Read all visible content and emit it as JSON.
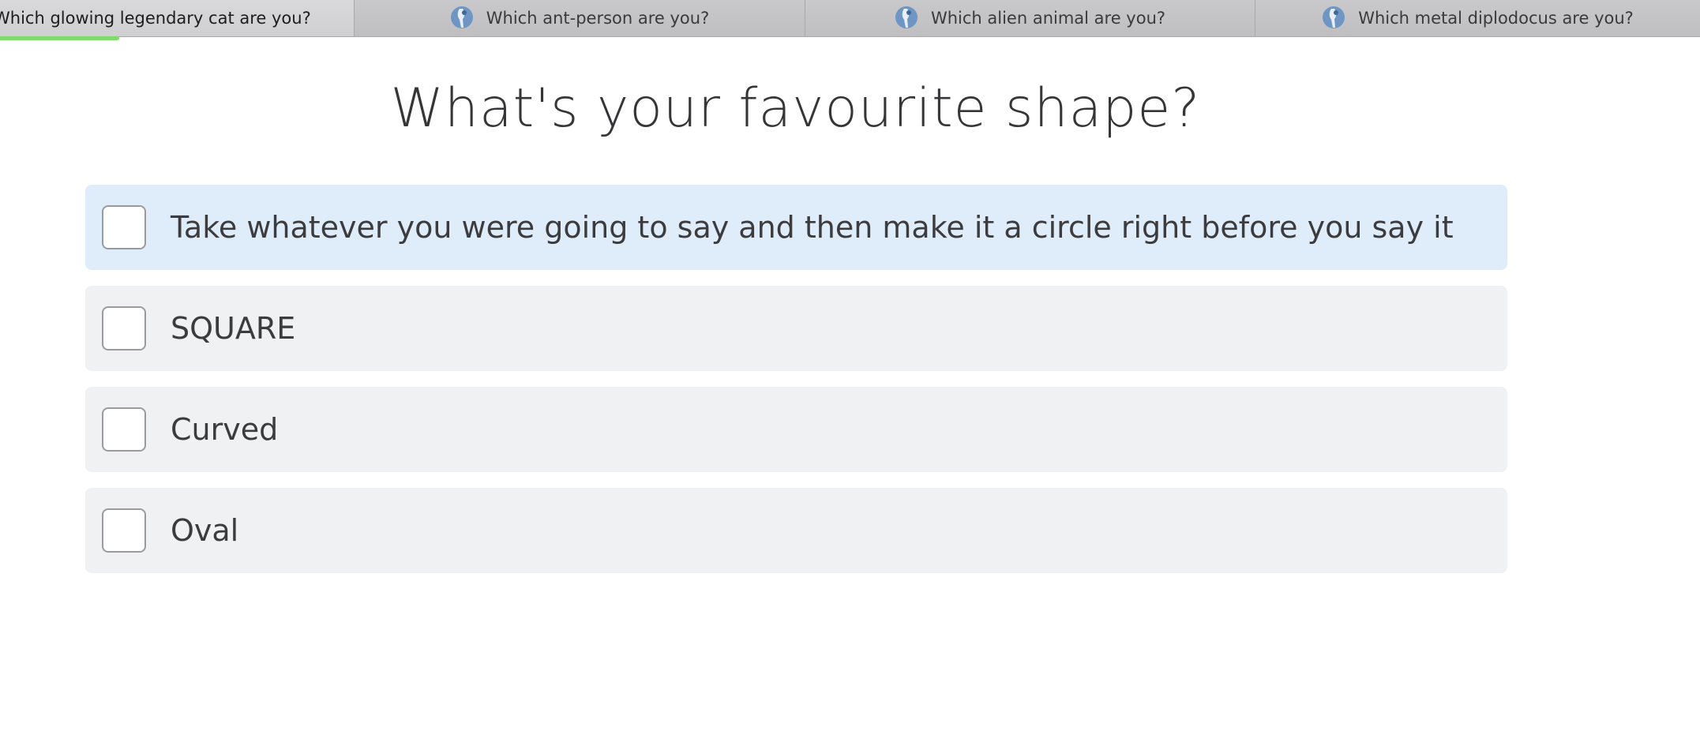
{
  "tabs": [
    {
      "label": "Which glowing legendary cat are you?",
      "active": true,
      "icon": "quiz-favicon"
    },
    {
      "label": "Which ant-person are you?",
      "active": false,
      "icon": "quiz-favicon"
    },
    {
      "label": "Which alien animal are you?",
      "active": false,
      "icon": "quiz-favicon"
    },
    {
      "label": "Which metal diplodocus are you?",
      "active": false,
      "icon": "quiz-favicon"
    }
  ],
  "progress": {
    "fraction": 0.07
  },
  "question": {
    "title": "What's your favourite shape?",
    "options": [
      {
        "label": "Take whatever you were going to say and then make it a circle right before you say it",
        "checked": false,
        "highlighted": true
      },
      {
        "label": "SQUARE",
        "checked": false,
        "highlighted": false
      },
      {
        "label": "Curved",
        "checked": false,
        "highlighted": false
      },
      {
        "label": "Oval",
        "checked": false,
        "highlighted": false
      }
    ]
  },
  "colors": {
    "accent_progress": "#7ddc6a",
    "option_bg": "#f0f1f3",
    "option_highlight_bg": "#dfedfa"
  }
}
